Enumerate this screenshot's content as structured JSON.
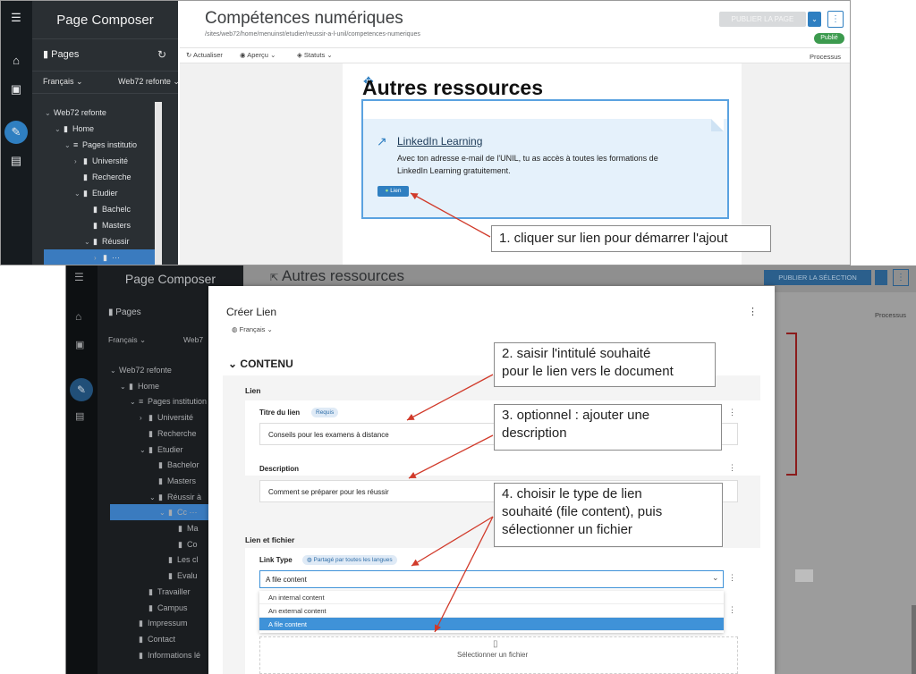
{
  "top": {
    "app_name": "Page Composer",
    "pages_label": "Pages",
    "language": "Français",
    "site": "Web72 refonte",
    "tree": [
      {
        "label": "Web72 refonte",
        "level": 0,
        "chev": "⌄",
        "icon": ""
      },
      {
        "label": "Home",
        "level": 1,
        "chev": "⌄",
        "icon": "page"
      },
      {
        "label": "Pages institutio",
        "level": 2,
        "chev": "⌄",
        "icon": "list"
      },
      {
        "label": "Université",
        "level": 3,
        "chev": "›",
        "icon": "page"
      },
      {
        "label": "Recherche",
        "level": 3,
        "chev": "",
        "icon": "page"
      },
      {
        "label": "Etudier",
        "level": 3,
        "chev": "⌄",
        "icon": "page"
      },
      {
        "label": "Bachelc",
        "level": 4,
        "chev": "",
        "icon": "page"
      },
      {
        "label": "Masters",
        "level": 4,
        "chev": "",
        "icon": "page"
      },
      {
        "label": "Réussir",
        "level": 4,
        "chev": "⌄",
        "icon": "page"
      },
      {
        "label": "···",
        "level": 5,
        "chev": "›",
        "icon": "page",
        "selected": true
      }
    ],
    "page_title": "Compétences numériques",
    "page_path": "/sites/web72/home/menuinst/etudier/reussir-a-l-unil/competences-numeriques",
    "publish_button": "PUBLIER LA PAGE",
    "status_badge": "Publié",
    "toolbar": {
      "refresh": "Actualiser",
      "preview": "Aperçu",
      "status": "Statuts",
      "process": "Processus"
    },
    "section_heading": "Autres ressources",
    "card_title": "LinkedIn Learning",
    "card_text_1": "Avec ton adresse e-mail de l'UNIL, tu as accès à toutes les formations de",
    "card_text_2": "LinkedIn Learning gratuitement.",
    "link_button": "Lien",
    "callout_1": "1. cliquer sur lien pour démarrer l'ajout"
  },
  "bottom": {
    "app_name": "Page Composer",
    "pages_label": "Pages",
    "language": "Français",
    "site_short": "Web7",
    "header_title": "Autres ressources",
    "publish_selection": "PUBLIER LA SÉLECTION",
    "process": "Processus",
    "tree": [
      {
        "label": "Web72 refonte",
        "level": 0,
        "chev": "⌄",
        "icon": ""
      },
      {
        "label": "Home",
        "level": 1,
        "chev": "⌄",
        "icon": "page"
      },
      {
        "label": "Pages institution",
        "level": 2,
        "chev": "⌄",
        "icon": "list"
      },
      {
        "label": "Université",
        "level": 3,
        "chev": "›",
        "icon": "page"
      },
      {
        "label": "Recherche",
        "level": 3,
        "chev": "",
        "icon": "page"
      },
      {
        "label": "Etudier",
        "level": 3,
        "chev": "⌄",
        "icon": "page"
      },
      {
        "label": "Bachelor",
        "level": 4,
        "chev": "",
        "icon": "page"
      },
      {
        "label": "Masters",
        "level": 4,
        "chev": "",
        "icon": "page"
      },
      {
        "label": "Réussir à",
        "level": 4,
        "chev": "⌄",
        "icon": "page"
      },
      {
        "label": "Cc ···",
        "level": 5,
        "chev": "⌄",
        "icon": "page",
        "selected": true
      },
      {
        "label": "Ma",
        "level": 6,
        "chev": "",
        "icon": "page"
      },
      {
        "label": "Co",
        "level": 6,
        "chev": "",
        "icon": "page"
      },
      {
        "label": "Les cl",
        "level": 5,
        "chev": "",
        "icon": "page"
      },
      {
        "label": "Evalu",
        "level": 5,
        "chev": "",
        "icon": "page"
      },
      {
        "label": "Travailler",
        "level": 3,
        "chev": "",
        "icon": "page"
      },
      {
        "label": "Campus",
        "level": 3,
        "chev": "",
        "icon": "page"
      },
      {
        "label": "Impressum",
        "level": 2,
        "chev": "",
        "icon": "page"
      },
      {
        "label": "Contact",
        "level": 2,
        "chev": "",
        "icon": "page"
      },
      {
        "label": "Informations lé",
        "level": 2,
        "chev": "",
        "icon": "page"
      }
    ],
    "dialog": {
      "title": "Créer Lien",
      "language": "Français",
      "section": "CONTENU",
      "group_link": "Lien",
      "title_label": "Titre du lien",
      "required": "Requis",
      "title_value": "Conseils pour les examens à distance",
      "description_label": "Description",
      "description_value": "Comment se préparer pour les réussir",
      "group_link_file": "Lien et fichier",
      "link_type_label": "Link Type",
      "shared_chip": "Partagé par toutes les langues",
      "link_type_value": "A file content",
      "options": [
        "An internal content",
        "An external content",
        "A file content"
      ],
      "select_file": "Sélectionner un fichier"
    },
    "callout_2": [
      "2. saisir l'intitulé souhaité",
      "pour le lien vers le document"
    ],
    "callout_3": [
      "3. optionnel : ajouter une",
      "description"
    ],
    "callout_4": [
      "4. choisir le type de lien",
      "souhaité (file content), puis",
      "sélectionner un fichier"
    ]
  },
  "colors": {
    "accent": "#2f7fc1",
    "rail": "#161b1f",
    "sidebar": "#2a2f33",
    "annotation_arrow": "#d13a2a",
    "published": "#3c9a4e"
  }
}
